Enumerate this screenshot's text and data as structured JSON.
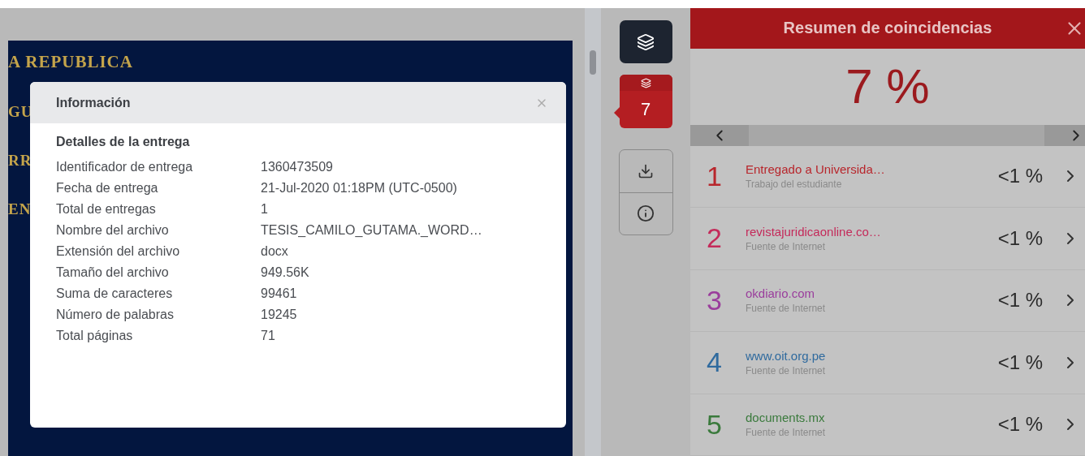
{
  "document": {
    "heading": "A REPUBLICA",
    "fragments": [
      "GU",
      "RR",
      "EN"
    ]
  },
  "info_dialog": {
    "title": "Información",
    "section": "Detalles de la entrega",
    "fields": [
      {
        "label": "Identificador de entrega",
        "value": "1360473509"
      },
      {
        "label": "Fecha de entrega",
        "value": "21-Jul-2020 01:18PM (UTC-0500)"
      },
      {
        "label": "Total de entregas",
        "value": "1"
      },
      {
        "label": "Nombre del archivo",
        "value": "TESIS_CAMILO_GUTAMA._WORD…"
      },
      {
        "label": "Extensión del archivo",
        "value": "docx"
      },
      {
        "label": "Tamaño del archivo",
        "value": "949.56K"
      },
      {
        "label": "Suma de caracteres",
        "value": "99461"
      },
      {
        "label": "Número de palabras",
        "value": "19245"
      },
      {
        "label": "Total páginas",
        "value": "71"
      }
    ]
  },
  "toolbar": {
    "match_count": "7"
  },
  "match_panel": {
    "title": "Resumen de coincidencias",
    "score": "7 %",
    "matches": [
      {
        "number": "1",
        "source": "Entregado a Universida…",
        "type": "Trabajo del estudiante",
        "percent": "<1 %",
        "color": "#b8262c"
      },
      {
        "number": "2",
        "source": "revistajuridicaonline.co…",
        "type": "Fuente de Internet",
        "percent": "<1 %",
        "color": "#c42a5a"
      },
      {
        "number": "3",
        "source": "okdiario.com",
        "type": "Fuente de Internet",
        "percent": "<1 %",
        "color": "#9a3d9c"
      },
      {
        "number": "4",
        "source": "www.oit.org.pe",
        "type": "Fuente de Internet",
        "percent": "<1 %",
        "color": "#2f6a9e"
      },
      {
        "number": "5",
        "source": "documents.mx",
        "type": "Fuente de Internet",
        "percent": "<1 %",
        "color": "#3a7a3c"
      }
    ]
  }
}
